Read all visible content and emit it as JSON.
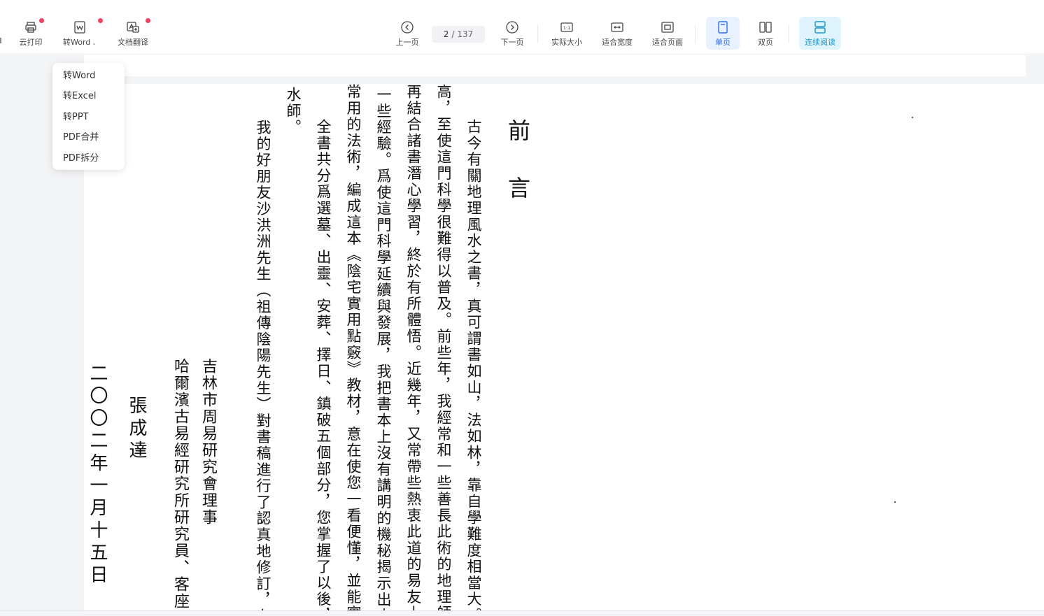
{
  "toolbar": {
    "left": [
      {
        "name": "cloud-print",
        "label": "云打印",
        "icon": "printer-icon"
      },
      {
        "name": "to-word",
        "label": "转Word",
        "icon": "word-icon"
      },
      {
        "name": "doc-translate",
        "label": "文档翻译",
        "icon": "translate-icon"
      }
    ],
    "nav": {
      "prev_label": "上一页",
      "next_label": "下一页",
      "current_page": "2",
      "total_pages": "/ 137"
    },
    "view": {
      "actual_size": "实际大小",
      "fit_width": "适合宽度",
      "fit_page": "适合页面",
      "single_page": "单页",
      "double_page": "双页",
      "continuous": "连续阅读"
    },
    "colors": {
      "accent": "#2f6bf0",
      "continuous": "#1796c8",
      "badge": "#f2415f"
    }
  },
  "dropdown": {
    "items": [
      "转Word",
      "转Excel",
      "转PPT",
      "PDF合并",
      "PDF拆分"
    ]
  },
  "document": {
    "title": "前言",
    "paragraphs": [
      "古今有關地理風水之書，真可謂書如山，法如林，靠自學難度相當大。",
      "高，至使這門科學很難得以普及。前些年，我經常和一些善長此術的地理師",
      "再結合諸書潛心學習，終於有所體悟。近幾年，又常帶些熱衷此道的易友上",
      "一些經驗。爲使這門科學延續與發展，我把書本上沒有講明的機秘揭示出來",
      "常用的法術，編成這本《陰宅實用點竅》教材，意在使您一看便懂，並能實",
      "水師。",
      "全書共分爲選墓、出靈、安葬、擇日、鎮破五個部分，您掌握了以後，",
      "我的好朋友沙洪洲先生（祖傳陰陽先生）對書稿進行了認真地修訂，在"
    ],
    "signature": {
      "title1": "吉林市周易研究會理事",
      "title2": "哈爾濱古易經研究所研究員、客座",
      "name": "張成達",
      "date": "二〇〇二年一月十五日"
    }
  }
}
